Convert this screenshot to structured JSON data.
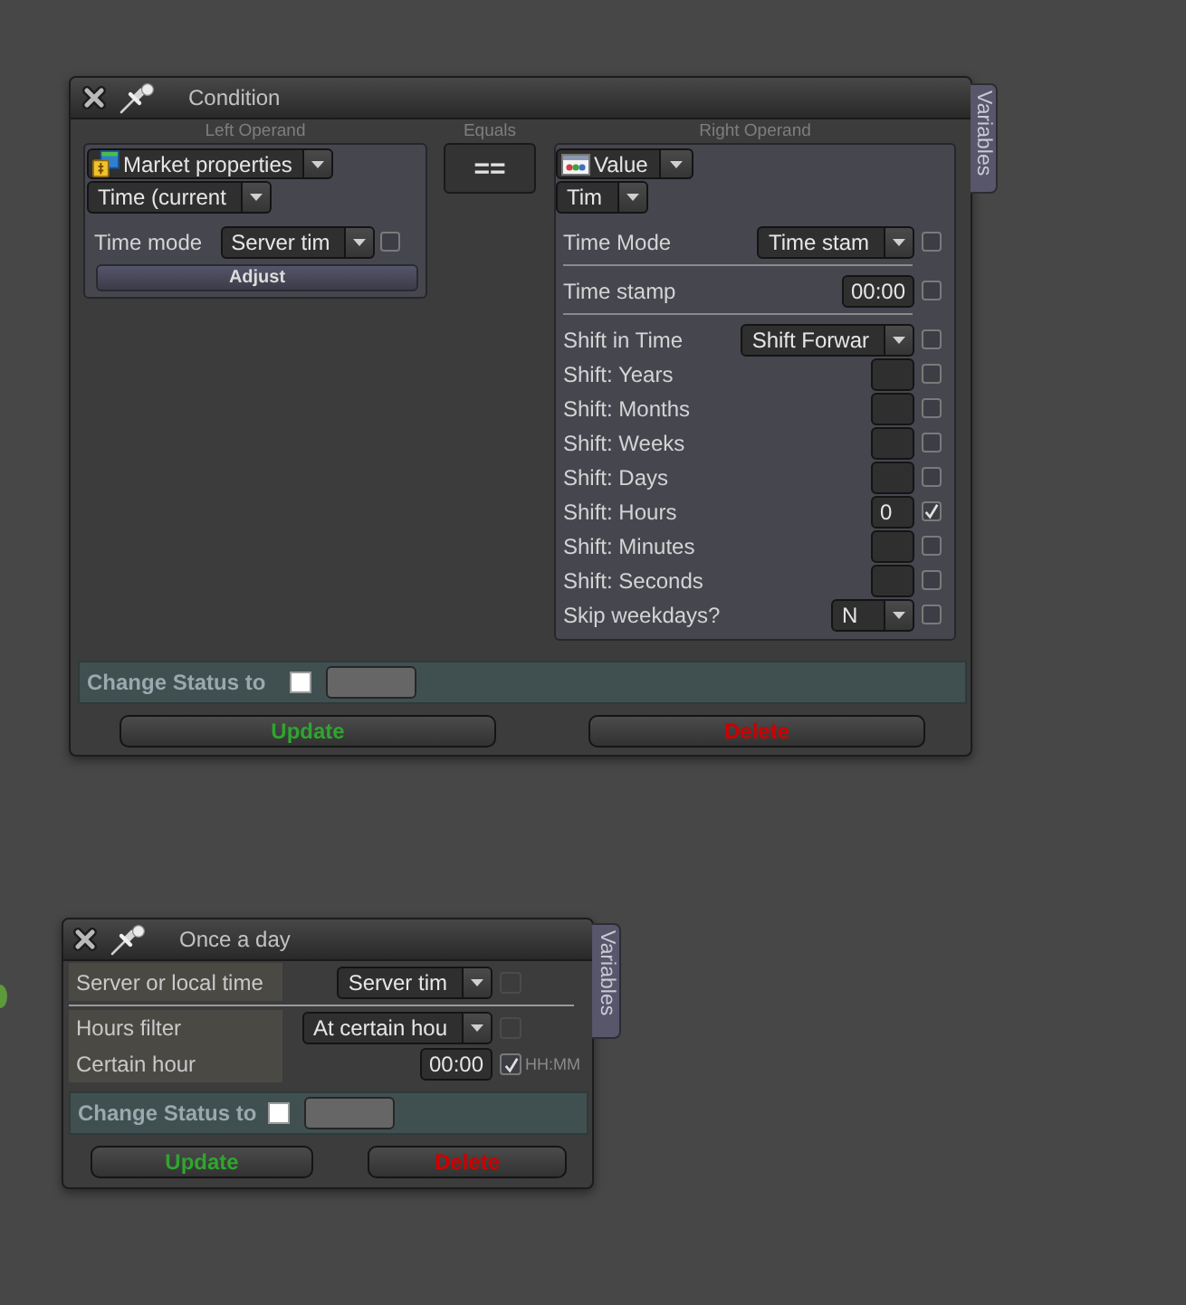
{
  "windows": [
    {
      "kind": "condition",
      "title": "Condition",
      "side_tab": "Variables",
      "left_operand": {
        "heading": "Left Operand",
        "source": "Market properties",
        "field": "Time (current",
        "rows": [
          {
            "label": "Time mode",
            "kind": "dropdown",
            "value": "Server tim",
            "checked": false
          }
        ],
        "button": "Adjust"
      },
      "operator": {
        "heading": "Equals",
        "value": "=="
      },
      "right_operand": {
        "heading": "Right Operand",
        "source": "Value",
        "field": "Tim",
        "sections": [
          {
            "rows": [
              {
                "label": "Time Mode",
                "kind": "dropdown",
                "value": "Time stam",
                "checked": false
              }
            ]
          },
          {
            "rows": [
              {
                "label": "Time stamp",
                "kind": "input",
                "value": "00:00",
                "checked": false
              }
            ]
          },
          {
            "rows": [
              {
                "label": "Shift in Time",
                "kind": "dropdown",
                "value": "Shift Forwar",
                "checked": false
              },
              {
                "label": "Shift: Years",
                "kind": "input",
                "checked": false
              },
              {
                "label": "Shift: Months",
                "kind": "input",
                "checked": false
              },
              {
                "label": "Shift: Weeks",
                "kind": "input",
                "checked": false
              },
              {
                "label": "Shift: Days",
                "kind": "input",
                "checked": false
              },
              {
                "label": "Shift: Hours",
                "kind": "input",
                "value": "0",
                "checked": true
              },
              {
                "label": "Shift: Minutes",
                "kind": "input",
                "checked": false
              },
              {
                "label": "Shift: Seconds",
                "kind": "input",
                "checked": false
              },
              {
                "label": "Skip weekdays?",
                "kind": "dropdown",
                "value": "N",
                "checked": false
              }
            ]
          }
        ]
      },
      "status": {
        "label": "Change Status to",
        "checked": false
      },
      "buttons": [
        {
          "label": "Update",
          "kind": "update"
        },
        {
          "label": "Delete",
          "kind": "delete"
        }
      ]
    },
    {
      "kind": "schedule",
      "title": "Once a day",
      "side_tab": "Variables",
      "sections": [
        {
          "rows": [
            {
              "label": "Server or local time",
              "kind": "dropdown",
              "value": "Server tim",
              "checked": false,
              "disabled": true
            }
          ]
        },
        {
          "rows": [
            {
              "label": "Hours filter",
              "kind": "dropdown",
              "value": "At certain hou",
              "checked": false,
              "disabled": true
            },
            {
              "label": "Certain hour",
              "kind": "input",
              "value": "00:00",
              "checked": true,
              "disabled": false,
              "format": "HH:MM"
            }
          ]
        }
      ],
      "status": {
        "label": "Change Status to",
        "checked": false
      },
      "buttons": [
        {
          "label": "Update",
          "kind": "update"
        },
        {
          "label": "Delete",
          "kind": "delete"
        }
      ]
    }
  ]
}
